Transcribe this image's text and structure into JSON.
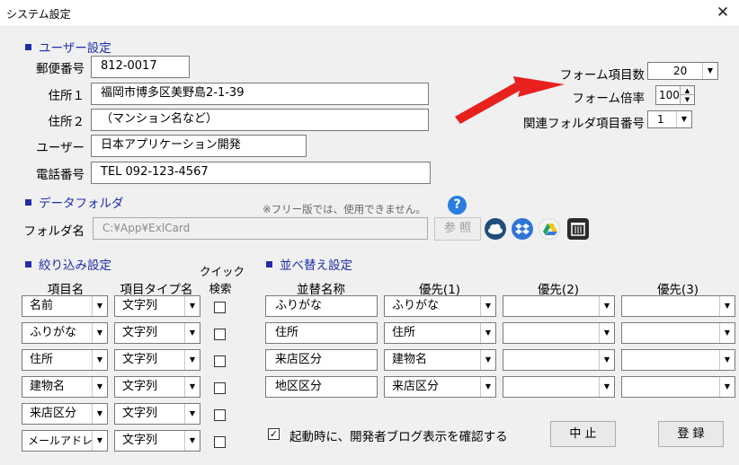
{
  "window": {
    "title": "システム設定",
    "close_glyph": "✕"
  },
  "user_settings": {
    "header": "ユーザー設定",
    "postal_label": "郵便番号",
    "postal_value": "812-0017",
    "address1_label": "住所１",
    "address1_value": "福岡市博多区美野島2-1-39",
    "address2_label": "住所２",
    "address2_value": "（マンション名など）",
    "user_label": "ユーザー",
    "user_value": "日本アプリケーション開発",
    "phone_label": "電話番号",
    "phone_value": "TEL 092-123-4567"
  },
  "form_settings": {
    "item_count_label": "フォーム項目数",
    "item_count_value": "20",
    "zoom_label": "フォーム倍率",
    "zoom_value": "100",
    "related_folder_label": "関連フォルダ項目番号",
    "related_folder_value": "1"
  },
  "data_folder": {
    "header": "データフォルダ",
    "notice": "※フリー版では、使用できません。",
    "folder_label": "フォルダ名",
    "folder_value": "C:¥App¥ExlCard",
    "browse_label": "参 照",
    "help_glyph": "?"
  },
  "filter_settings": {
    "header": "絞り込み設定",
    "col_item": "項目名",
    "col_type": "項目タイプ名",
    "col_quick_1": "クイック",
    "col_quick_2": "検索",
    "rows": [
      {
        "item": "名前",
        "type": "文字列"
      },
      {
        "item": "ふりがな",
        "type": "文字列"
      },
      {
        "item": "住所",
        "type": "文字列"
      },
      {
        "item": "建物名",
        "type": "文字列"
      },
      {
        "item": "来店区分",
        "type": "文字列"
      },
      {
        "item": "メールアドレ",
        "type": "文字列"
      }
    ]
  },
  "sort_settings": {
    "header": "並べ替え設定",
    "col_name": "並替名称",
    "col_p1": "優先(1)",
    "col_p2": "優先(2)",
    "col_p3": "優先(3)",
    "rows": [
      {
        "name": "ふりがな",
        "p1": "ふりがな",
        "p2": "",
        "p3": ""
      },
      {
        "name": "住所",
        "p1": "住所",
        "p2": "",
        "p3": ""
      },
      {
        "name": "来店区分",
        "p1": "建物名",
        "p2": "",
        "p3": ""
      },
      {
        "name": "地区区分",
        "p1": "来店区分",
        "p2": "",
        "p3": ""
      }
    ]
  },
  "footer": {
    "startup_checkbox_label": "起動時に、開発者ブログ表示を確認する",
    "startup_checked_glyph": "✓",
    "cancel_label": "中 止",
    "register_label": "登 録"
  },
  "annotation": {
    "arrow_color": "#e8211f"
  },
  "colors": {
    "section_header": "#1e2ea8"
  }
}
